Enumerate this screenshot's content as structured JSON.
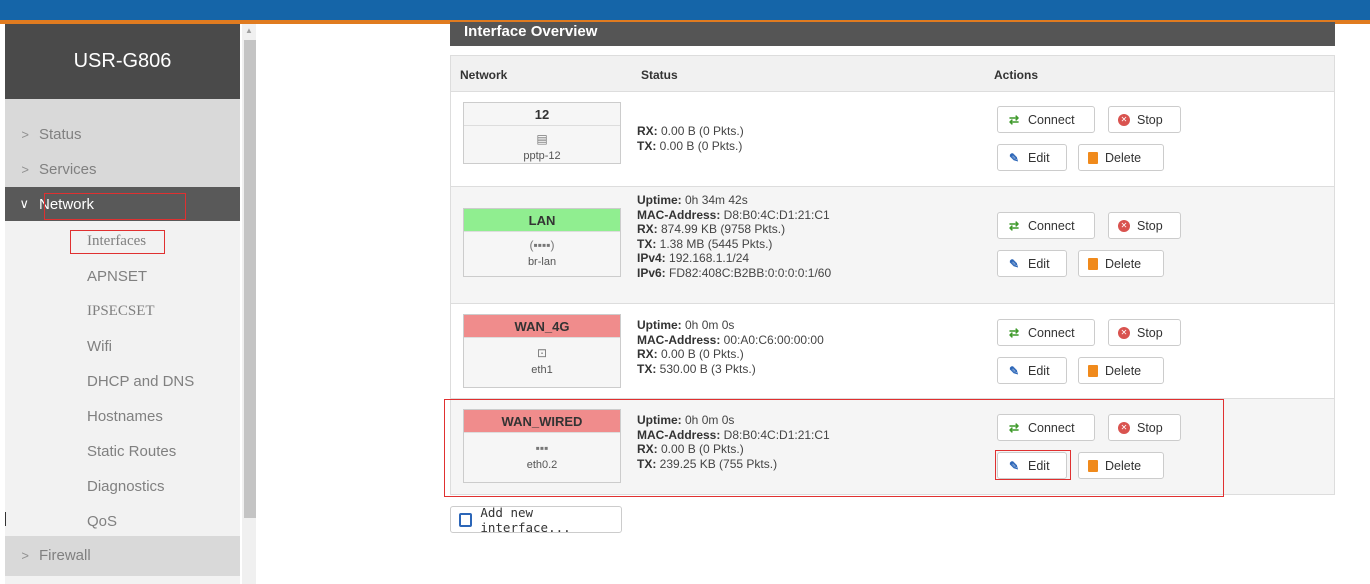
{
  "app": {
    "brand": "USR-G806"
  },
  "sidebar": {
    "items": [
      {
        "label": "Status",
        "chevron": ">"
      },
      {
        "label": "Services",
        "chevron": ">"
      },
      {
        "label": "Network",
        "chevron": "∨"
      }
    ],
    "network_submenu": [
      "Interfaces",
      "APNSET",
      "IPSECSET",
      "Wifi",
      "DHCP and DNS",
      "Hostnames",
      "Static Routes",
      "Diagnostics",
      "QoS"
    ],
    "firewall": {
      "label": "Firewall",
      "chevron": ">"
    }
  },
  "main": {
    "section_title": "Interface Overview",
    "columns": {
      "network": "Network",
      "status": "Status",
      "actions": "Actions"
    },
    "buttons": {
      "connect": "Connect",
      "stop": "Stop",
      "edit": "Edit",
      "delete": "Delete"
    },
    "interfaces": [
      {
        "name": "12",
        "icon": "tunnel-icon",
        "device": "pptp-12",
        "status": [
          {
            "label": "RX:",
            "value": " 0.00 B (0 Pkts.)"
          },
          {
            "label": "TX:",
            "value": " 0.00 B (0 Pkts.)"
          }
        ]
      },
      {
        "name": "LAN",
        "icon": "bridge-icon",
        "icon_text": "(▪▪▪▪)",
        "device": "br-lan",
        "color": "#90ee90",
        "status": [
          {
            "label": "Uptime:",
            "value": " 0h 34m 42s"
          },
          {
            "label": "MAC-Address:",
            "value": " D8:B0:4C:D1:21:C1"
          },
          {
            "label": "RX:",
            "value": " 874.99 KB (9758 Pkts.)"
          },
          {
            "label": "TX:",
            "value": " 1.38 MB (5445 Pkts.)"
          },
          {
            "label": "IPv4:",
            "value": " 192.168.1.1/24"
          },
          {
            "label": "IPv6:",
            "value": " FD82:408C:B2BB:0:0:0:0:1/60"
          }
        ]
      },
      {
        "name": "WAN_4G",
        "icon": "ethernet-port-icon",
        "device": "eth1",
        "color": "#f08c8c",
        "status": [
          {
            "label": "Uptime:",
            "value": " 0h 0m 0s"
          },
          {
            "label": "MAC-Address:",
            "value": " 00:A0:C6:00:00:00"
          },
          {
            "label": "RX:",
            "value": " 0.00 B (0 Pkts.)"
          },
          {
            "label": "TX:",
            "value": " 530.00 B (3 Pkts.)"
          }
        ]
      },
      {
        "name": "WAN_WIRED",
        "icon": "switch-port-icon",
        "device": "eth0.2",
        "color": "#f08c8c",
        "status": [
          {
            "label": "Uptime:",
            "value": " 0h 0m 0s"
          },
          {
            "label": "MAC-Address:",
            "value": " D8:B0:4C:D1:21:C1"
          },
          {
            "label": "RX:",
            "value": " 0.00 B (0 Pkts.)"
          },
          {
            "label": "TX:",
            "value": " 239.25 KB (755 Pkts.)"
          }
        ]
      }
    ],
    "add_button": "Add new interface..."
  }
}
